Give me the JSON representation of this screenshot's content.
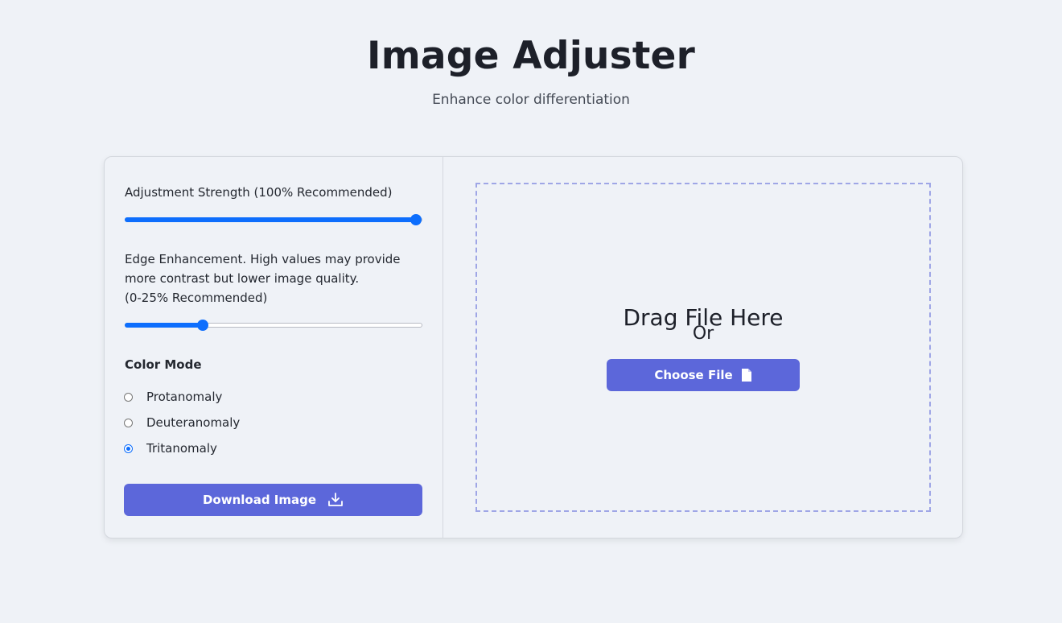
{
  "header": {
    "title": "Image Adjuster",
    "subtitle": "Enhance color differentiation"
  },
  "controls": {
    "strength_label": "Adjustment Strength (100% Recommended)",
    "strength_value_percent": 100,
    "edge_label_line1": "Edge Enhancement. High values may provide",
    "edge_label_line2": "more contrast but lower image quality.",
    "edge_label_line3": "(0-25% Recommended)",
    "edge_value_percent": 25,
    "color_mode_label": "Color Mode",
    "color_modes": [
      {
        "label": "Protanomaly",
        "checked": false
      },
      {
        "label": "Deuteranomaly",
        "checked": false
      },
      {
        "label": "Tritanomaly",
        "checked": true
      }
    ],
    "download_label": "Download Image",
    "download_icon": "download-icon"
  },
  "dropzone": {
    "title": "Drag File Here",
    "or_text": "Or",
    "choose_label": "Choose File",
    "choose_icon": "file-icon"
  },
  "colors": {
    "accent": "#5c67da",
    "slider": "#0d6efd",
    "background": "#eff2f7",
    "dropzone_border": "#9fa6e6"
  }
}
